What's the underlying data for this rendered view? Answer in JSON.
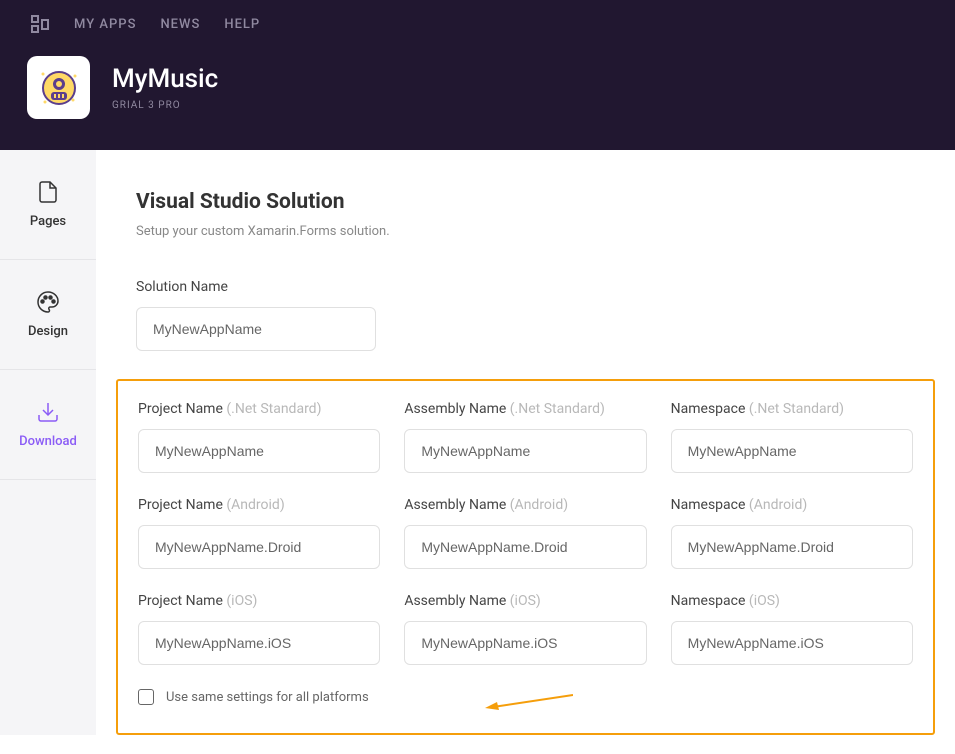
{
  "nav": {
    "myApps": "MY APPS",
    "news": "NEWS",
    "help": "HELP"
  },
  "app": {
    "title": "MyMusic",
    "subtitle": "GRIAL 3 PRO"
  },
  "sidebar": {
    "pages": "Pages",
    "design": "Design",
    "download": "Download"
  },
  "main": {
    "title": "Visual Studio Solution",
    "subtitle": "Setup your custom Xamarin.Forms solution.",
    "solutionName": {
      "label": "Solution Name",
      "value": "MyNewAppName"
    },
    "grid": {
      "projectName": {
        "label": "Project Name",
        "netStandard": "(.Net Standard)",
        "android": "(Android)",
        "ios": "(iOS)",
        "valueNet": "MyNewAppName",
        "valueAndroid": "MyNewAppName.Droid",
        "valueIos": "MyNewAppName.iOS"
      },
      "assemblyName": {
        "label": "Assembly Name",
        "netStandard": "(.Net Standard)",
        "android": "(Android)",
        "ios": "(iOS)",
        "valueNet": "MyNewAppName",
        "valueAndroid": "MyNewAppName.Droid",
        "valueIos": "MyNewAppName.iOS"
      },
      "namespace": {
        "label": "Namespace",
        "netStandard": "(.Net Standard)",
        "android": "(Android)",
        "ios": "(iOS)",
        "valueNet": "MyNewAppName",
        "valueAndroid": "MyNewAppName.Droid",
        "valueIos": "MyNewAppName.iOS"
      }
    },
    "checkbox": {
      "label": "Use same settings for all platforms"
    }
  }
}
